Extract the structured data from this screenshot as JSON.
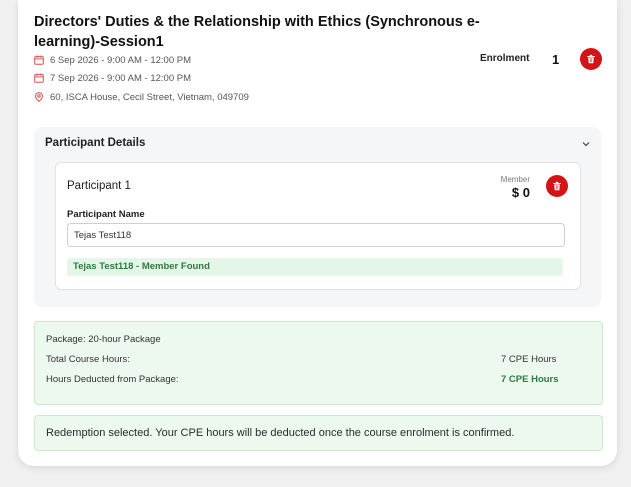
{
  "course": {
    "title": "Directors' Duties & the Relationship with Ethics (Synchronous e-learning)-Session1",
    "dates": [
      "6 Sep 2026 - 9:00 AM - 12:00 PM",
      "7 Sep 2026 - 9:00 AM - 12:00 PM"
    ],
    "location": "60, ISCA House, Cecil Street, Vietnam, 049709",
    "enrolment_label": "Enrolment",
    "enrolment_count": "1"
  },
  "participant_details": {
    "title": "Participant Details",
    "participant": {
      "title": "Participant 1",
      "member_label": "Member",
      "price": "$ 0",
      "name_label": "Participant Name",
      "name_value": "Tejas Test118",
      "status": "Tejas Test118 - Member Found"
    }
  },
  "package": {
    "name": "Package: 20-hour Package",
    "total_hours_label": "Total Course Hours:",
    "total_hours_value": "7 CPE Hours",
    "deducted_label": "Hours Deducted from Package:",
    "deducted_value": "7 CPE Hours"
  },
  "notice": "Redemption selected. Your CPE hours will be deducted once the course enrolment is confirmed.",
  "colors": {
    "danger": "#d41317",
    "success_text": "#2d7a3e",
    "success_bg": "#edf9ef",
    "icon_red": "#d9534f"
  },
  "icons": {
    "date": "calendar-icon",
    "location": "location-pin-icon",
    "delete": "trash-icon",
    "collapse": "chevron-down-icon"
  }
}
